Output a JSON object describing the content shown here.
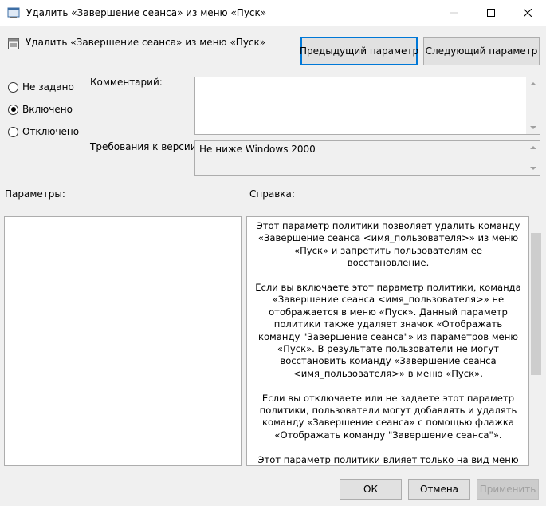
{
  "window": {
    "title": "Удалить «Завершение сеанса» из меню «Пуск»",
    "icon": "policy-window-icon"
  },
  "header": {
    "title": "Удалить «Завершение сеанса» из меню «Пуск»",
    "icon": "policy-setting-icon"
  },
  "buttons": {
    "previous": "Предыдущий параметр",
    "next": "Следующий параметр",
    "ok": "ОК",
    "cancel": "Отмена",
    "apply": "Применить"
  },
  "state": {
    "options": [
      {
        "label": "Не задано",
        "selected": false
      },
      {
        "label": "Включено",
        "selected": true
      },
      {
        "label": "Отключено",
        "selected": false
      }
    ]
  },
  "comment": {
    "label": "Комментарий:",
    "value": ""
  },
  "requirements": {
    "label": "Требования к версии:",
    "value": "Не ниже Windows 2000"
  },
  "sections": {
    "options_label": "Параметры:",
    "help_label": "Справка:"
  },
  "help": {
    "paragraphs": [
      "Этот параметр политики позволяет удалить команду «Завершение сеанса <имя_пользователя>» из меню «Пуск» и запретить пользователям ее восстановление.",
      "Если вы включаете этот параметр политики, команда «Завершение сеанса <имя_пользователя>» не отображается в меню «Пуск». Данный параметр политики также удаляет значок «Отображать команду \"Завершение сеанса\"» из параметров меню «Пуск». В результате пользователи не могут восстановить команду «Завершение сеанса <имя_пользователя>» в меню «Пуск».",
      "Если вы отключаете или не задаете этот параметр политики, пользователи могут добавлять и удалять команду «Завершение сеанса» с помощью флажка «Отображать команду \"Завершение сеанса\"».",
      "Этот параметр политики влияет только на вид меню «Пуск». Он не влияет на отображение команды «Завершение сеанса» в диалоговом окне «Безопасность Windows», которое открывается при нажатии клавиш CRTL+ALT+DEL, и не"
    ]
  }
}
